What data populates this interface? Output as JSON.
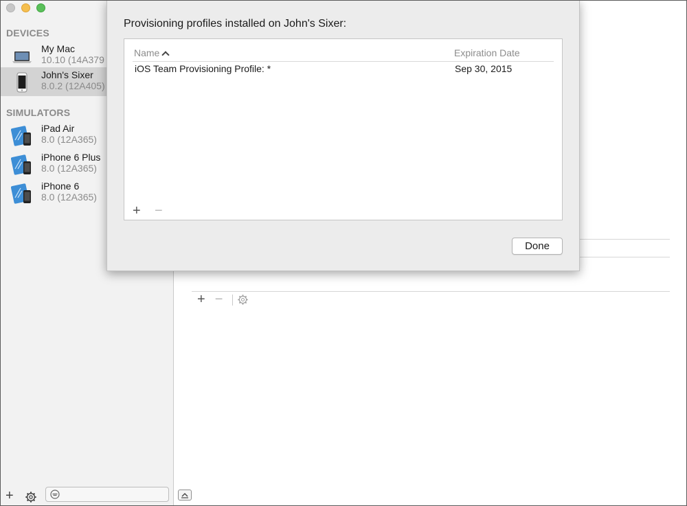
{
  "sidebar": {
    "devices_header": "DEVICES",
    "simulators_header": "SIMULATORS",
    "devices": [
      {
        "name": "My Mac",
        "sub": "10.10 (14A379",
        "icon": "laptop-icon"
      },
      {
        "name": "John's Sixer",
        "sub": "8.0.2 (12A405)",
        "icon": "iphone-icon",
        "selected": true
      }
    ],
    "simulators": [
      {
        "name": "iPad Air",
        "sub": "8.0 (12A365)",
        "icon": "simulator-icon"
      },
      {
        "name": "iPhone 6 Plus",
        "sub": "8.0 (12A365)",
        "icon": "simulator-icon"
      },
      {
        "name": "iPhone 6",
        "sub": "8.0 (12A365)",
        "icon": "simulator-icon"
      }
    ],
    "bottom": {
      "add": "+",
      "settings_icon": "gear-icon"
    }
  },
  "main": {
    "table_toolbar": {
      "add": "+",
      "remove": "−",
      "settings_icon": "gear-icon"
    }
  },
  "sheet": {
    "title": "Provisioning profiles installed on John's Sixer:",
    "columns": {
      "name": "Name",
      "expiration": "Expiration Date"
    },
    "rows": [
      {
        "name": "iOS Team Provisioning Profile: *",
        "expiration": "Sep 30, 2015"
      }
    ],
    "add": "+",
    "remove": "−",
    "done_label": "Done"
  },
  "colors": {
    "sidebar_bg": "#f2f2f2",
    "selected_row": "#d3d3d3",
    "section_header": "#8a8a8a",
    "sheet_bg": "#ececec",
    "traffic_red_inactive": "#c7c7c7",
    "traffic_yellow": "#f5bf4f",
    "traffic_green": "#5ac05a"
  }
}
